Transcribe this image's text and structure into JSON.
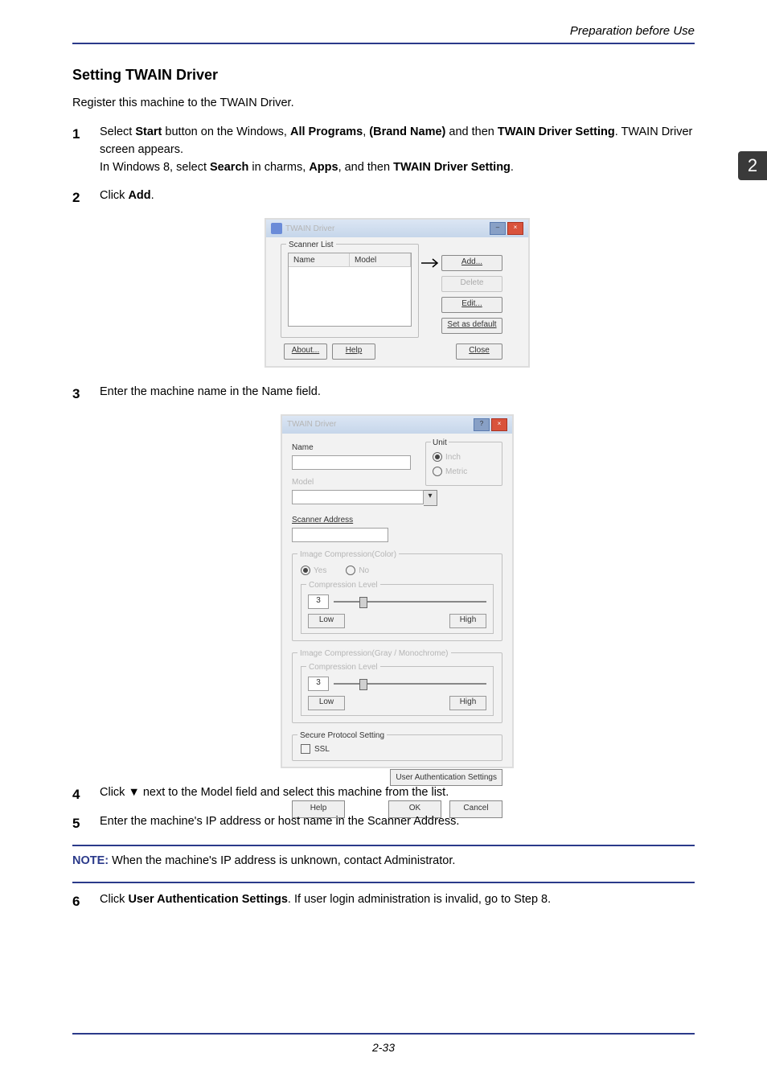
{
  "header": {
    "section": "Preparation before Use"
  },
  "tab": {
    "number": "2"
  },
  "heading": "Setting TWAIN Driver",
  "lead": "Register this machine to the TWAIN Driver.",
  "steps": {
    "s1a": "Select ",
    "s1_start": "Start",
    "s1b": " button on the Windows, ",
    "s1_allp": "All Programs",
    "s1c": ", ",
    "s1_brand": "(Brand Name)",
    "s1d": " and then ",
    "s1_twain": "TWAIN Driver Setting",
    "s1e": ". TWAIN Driver screen appears.",
    "s1f": "In Windows 8, select ",
    "s1_search": "Search",
    "s1g": " in charms, ",
    "s1_apps": "Apps",
    "s1h": ", and then ",
    "s1i": ".",
    "s2a": "Click ",
    "s2_add": "Add",
    "s2b": ".",
    "s3": "Enter the machine name in the Name field.",
    "s4": "Click ▼ next to the Model field and select this machine from the list.",
    "s5": "Enter the machine's IP address or host name in the Scanner Address.",
    "s6a": "Click ",
    "s6_uas": "User Authentication Settings",
    "s6b": ". If user login administration is invalid, go to Step 8."
  },
  "dlg1": {
    "title": "TWAIN Driver",
    "scanner_list": "Scanner List",
    "col_name": "Name",
    "col_model": "Model",
    "add": "Add...",
    "delete": "Delete",
    "edit": "Edit...",
    "set_default": "Set as default",
    "about": "About...",
    "help": "Help",
    "close": "Close"
  },
  "dlg2": {
    "title": "TWAIN Driver",
    "name": "Name",
    "model": "Model",
    "scanner_addr": "Scanner Address",
    "unit": "Unit",
    "unit_inch": "Inch",
    "unit_metric": "Metric",
    "ic_color": "Image Compression(Color)",
    "yes": "Yes",
    "no": "No",
    "comp_level": "Compression Level",
    "comp_val": "3",
    "low": "Low",
    "high": "High",
    "ic_gray": "Image Compression(Gray / Monochrome)",
    "secure": "Secure Protocol Setting",
    "ssl": "SSL",
    "uas": "User Authentication Settings",
    "help": "Help",
    "ok": "OK",
    "cancel": "Cancel"
  },
  "note": {
    "label": "NOTE:",
    "text": " When the machine's IP address is unknown, contact Administrator."
  },
  "footer": {
    "pagenum": "2-33"
  }
}
